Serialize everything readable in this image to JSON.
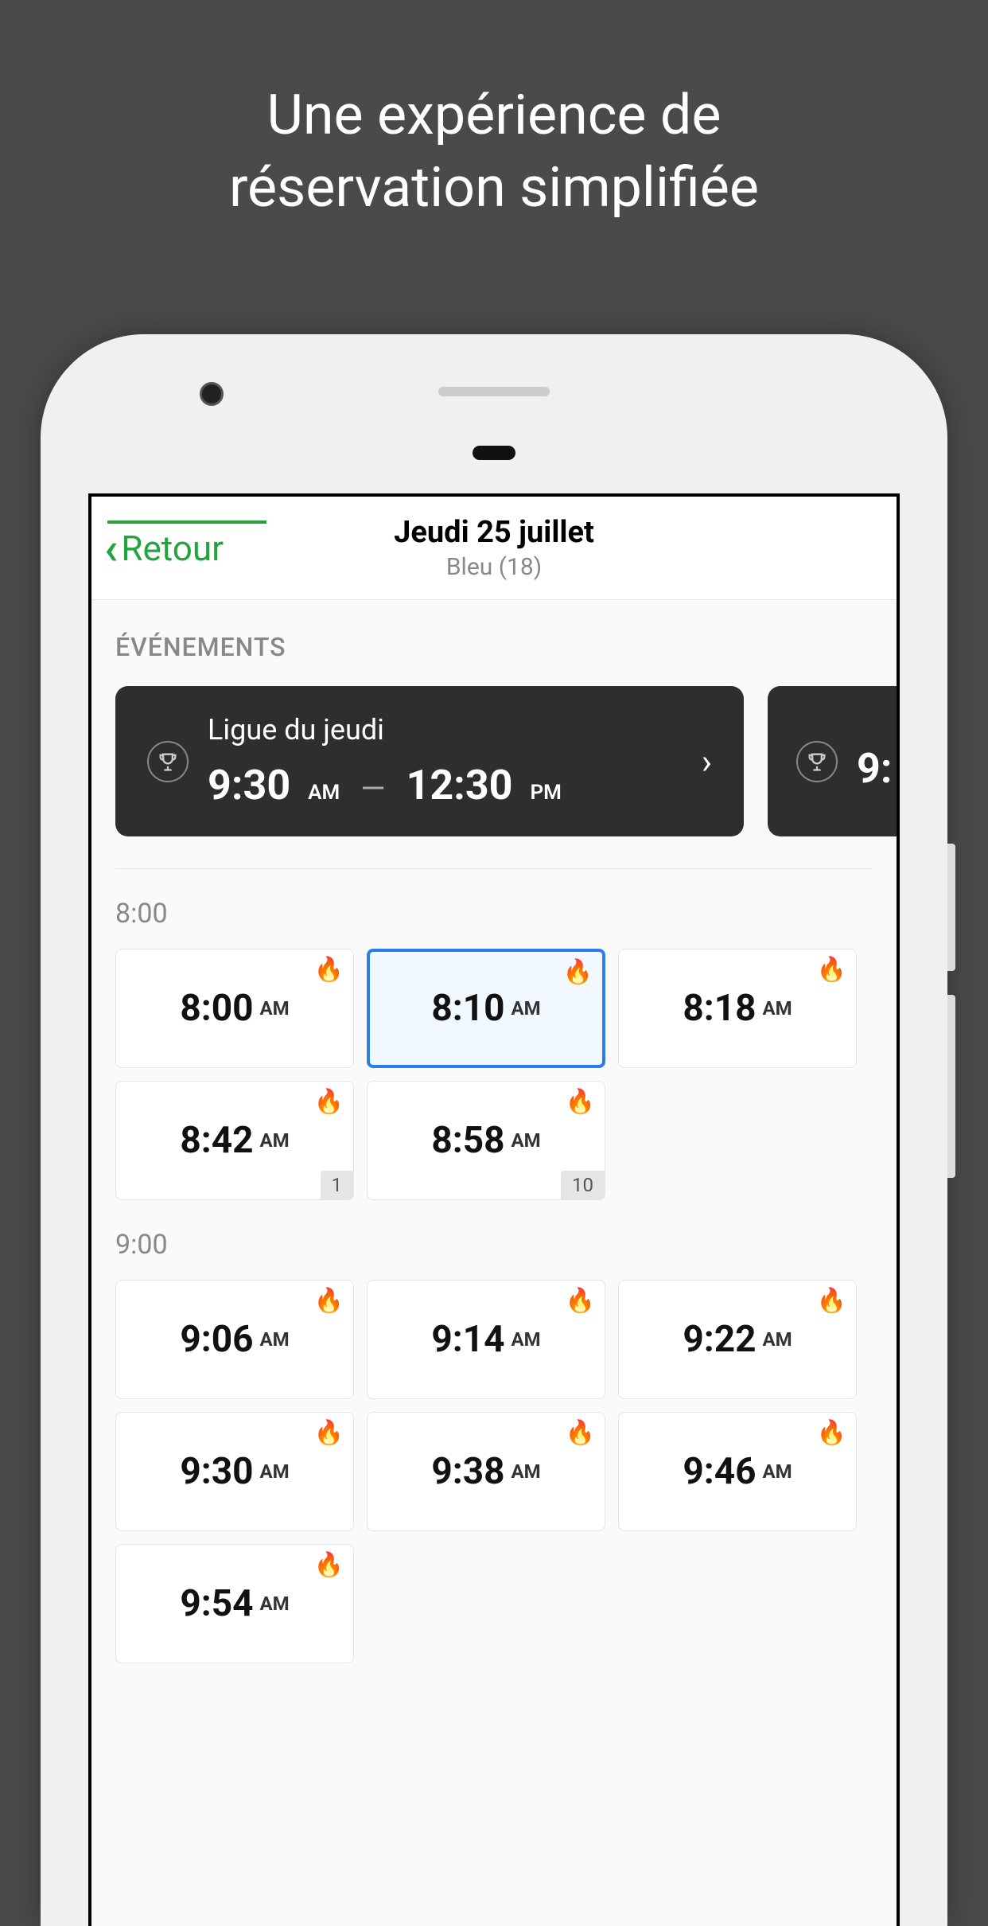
{
  "promo": {
    "line1": "Une expérience de",
    "line2": "réservation simplifiée"
  },
  "header": {
    "back_label": "Retour",
    "title": "Jeudi 25 juillet",
    "subtitle": "Bleu (18)"
  },
  "events_section": {
    "label": "ÉVÉNEMENTS"
  },
  "events": [
    {
      "title": "Ligue du jeudi",
      "start_time": "9:30",
      "start_ampm": "AM",
      "end_time": "12:30",
      "end_ampm": "PM"
    },
    {
      "title": "",
      "start_time": "9:",
      "start_ampm": "",
      "end_time": "",
      "end_ampm": ""
    }
  ],
  "hours": [
    {
      "label": "8:00",
      "slots": [
        {
          "time": "8:00",
          "ampm": "AM",
          "hot": true,
          "selected": false,
          "badge": null
        },
        {
          "time": "8:10",
          "ampm": "AM",
          "hot": true,
          "selected": true,
          "badge": null
        },
        {
          "time": "8:18",
          "ampm": "AM",
          "hot": true,
          "selected": false,
          "badge": null
        },
        {
          "time": "8:42",
          "ampm": "AM",
          "hot": true,
          "selected": false,
          "badge": "1"
        },
        {
          "time": "8:58",
          "ampm": "AM",
          "hot": true,
          "selected": false,
          "badge": "10"
        }
      ]
    },
    {
      "label": "9:00",
      "slots": [
        {
          "time": "9:06",
          "ampm": "AM",
          "hot": true,
          "selected": false,
          "badge": null
        },
        {
          "time": "9:14",
          "ampm": "AM",
          "hot": true,
          "selected": false,
          "badge": null
        },
        {
          "time": "9:22",
          "ampm": "AM",
          "hot": true,
          "selected": false,
          "badge": null
        },
        {
          "time": "9:30",
          "ampm": "AM",
          "hot": true,
          "selected": false,
          "badge": null
        },
        {
          "time": "9:38",
          "ampm": "AM",
          "hot": true,
          "selected": false,
          "badge": null
        },
        {
          "time": "9:46",
          "ampm": "AM",
          "hot": true,
          "selected": false,
          "badge": null
        },
        {
          "time": "9:54",
          "ampm": "AM",
          "hot": true,
          "selected": false,
          "badge": null
        }
      ]
    }
  ],
  "icons": {
    "flame": "🔥",
    "trophy": "🏆",
    "dash": "—"
  }
}
